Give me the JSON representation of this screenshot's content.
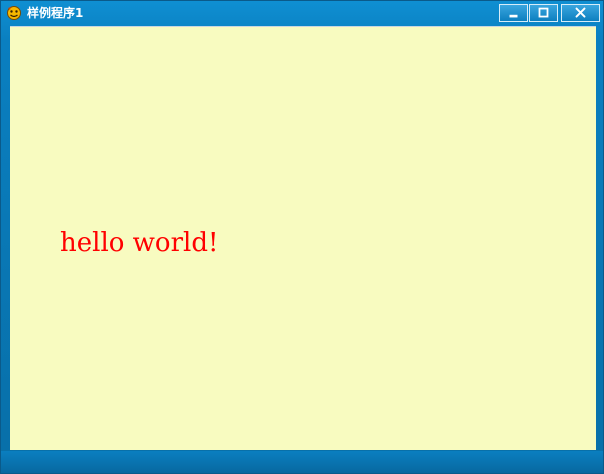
{
  "window": {
    "title": "样例程序1",
    "app_icon": "app-icon",
    "controls": {
      "minimize_icon": "minimize-icon",
      "maximize_icon": "maximize-icon",
      "close_icon": "close-icon"
    }
  },
  "client": {
    "message": "hello world!",
    "background_color": "#f8fbc0",
    "text_color": "#ff0000"
  },
  "theme": {
    "frame_color": "#0a7fc0"
  }
}
